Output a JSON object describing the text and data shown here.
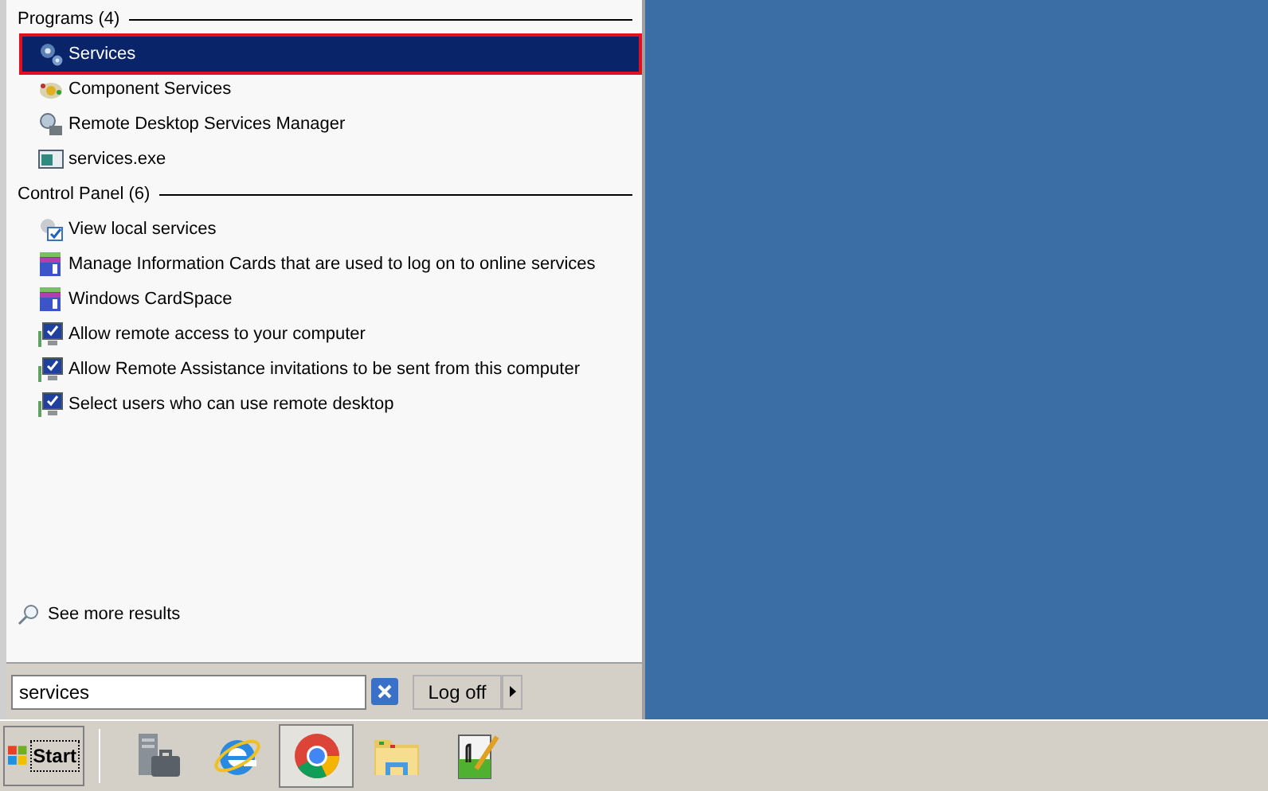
{
  "start_menu": {
    "groups": [
      {
        "header": "Programs (4)",
        "items": [
          {
            "label": "Services",
            "kind": "gears",
            "selected": true
          },
          {
            "label": "Component Services",
            "kind": "component",
            "selected": false
          },
          {
            "label": "Remote Desktop Services Manager",
            "kind": "manager",
            "selected": false
          },
          {
            "label": "services.exe",
            "kind": "exe",
            "selected": false
          }
        ]
      },
      {
        "header": "Control Panel (6)",
        "items": [
          {
            "label": "View local services",
            "kind": "tool",
            "selected": false
          },
          {
            "label": "Manage Information Cards that are used to log on to online services",
            "kind": "card",
            "selected": false
          },
          {
            "label": "Windows CardSpace",
            "kind": "card",
            "selected": false
          },
          {
            "label": "Allow remote access to your computer",
            "kind": "remote",
            "selected": false
          },
          {
            "label": "Allow Remote Assistance invitations to be sent from this computer",
            "kind": "remote",
            "selected": false
          },
          {
            "label": "Select users who can use remote desktop",
            "kind": "remote",
            "selected": false
          }
        ]
      }
    ],
    "see_more": "See more results",
    "search": {
      "value": "services"
    },
    "log_off": "Log off"
  },
  "taskbar": {
    "start": "Start",
    "apps": [
      {
        "kind": "server",
        "active": false
      },
      {
        "kind": "browser",
        "active": false
      },
      {
        "kind": "chrome",
        "active": true
      },
      {
        "kind": "folder",
        "active": false
      },
      {
        "kind": "notepad",
        "active": false
      }
    ]
  }
}
